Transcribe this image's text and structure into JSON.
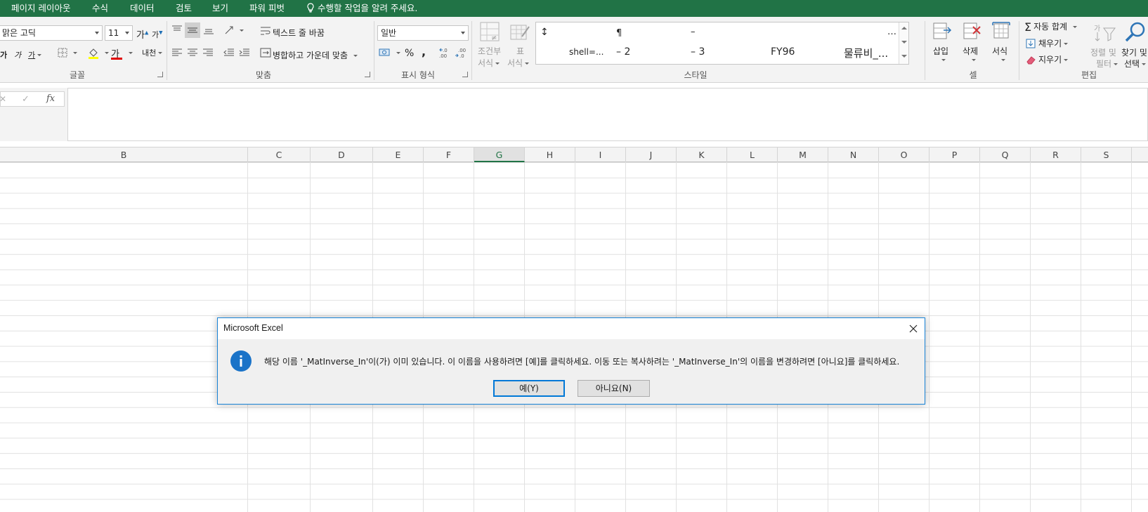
{
  "ribbon_tabs": [
    "페이지 레이아웃",
    "수식",
    "데이터",
    "검토",
    "보기",
    "파워 피벗"
  ],
  "tell_me": "수행할 작업을 알려 주세요.",
  "font_group": {
    "font_name": "맑은 고딕",
    "font_size": "11",
    "grow_font": "가",
    "shrink_font": "가",
    "bold": "가",
    "italic": "가",
    "underline": "가",
    "font_color_glyph": "가",
    "phonetic": "내천",
    "label": "글꼴"
  },
  "alignment_group": {
    "wrap_text": "텍스트 줄 바꿈",
    "merge_center": "병합하고 가운데 맞춤",
    "label": "맞춤"
  },
  "number_group": {
    "format": "일반",
    "percent": "%",
    "comma": ",",
    "label": "표시 형식"
  },
  "styles_group": {
    "conditional_formatting": [
      "조건부",
      "서식"
    ],
    "format_as_table": [
      "표",
      "서식"
    ],
    "gallery_row1": [
      "↕",
      "¶",
      "–",
      "…"
    ],
    "gallery_row2": [
      "shell=...",
      "– 2",
      "– 3",
      "FY96",
      "물류비_..."
    ],
    "label": "스타일"
  },
  "cells_group": {
    "insert": "삽입",
    "delete": "삭제",
    "format": "서식",
    "label": "셀"
  },
  "editing_group": {
    "autosum": "자동 합계",
    "fill": "채우기",
    "clear": "지우기",
    "sort_filter": [
      "정렬 및",
      "필터"
    ],
    "find_select": [
      "찾기 및",
      "선택"
    ],
    "label": "편집"
  },
  "formula_bar": {
    "cancel": "✕",
    "enter": "✓",
    "fx": "fx",
    "value": ""
  },
  "columns": [
    "B",
    "C",
    "D",
    "E",
    "F",
    "G",
    "H",
    "I",
    "J",
    "K",
    "L",
    "M",
    "N",
    "O",
    "P",
    "Q",
    "R",
    "S"
  ],
  "selected_column": "G",
  "dialog": {
    "title": "Microsoft Excel",
    "message": "해당 이름 '_MatInverse_In'이(가) 이미 있습니다. 이 이름을 사용하려면 [예]를 클릭하세요. 이동 또는 복사하려는 '_MatInverse_In'의 이름을 변경하려면 [아니요]를 클릭하세요.",
    "yes_button": "예(Y)",
    "no_button": "아니요(N)",
    "close": "✕"
  },
  "colors": {
    "ribbon_green": "#217346",
    "dialog_border": "#1883d7",
    "info_icon": "#1a73c8",
    "default_button_border": "#0078d7"
  }
}
